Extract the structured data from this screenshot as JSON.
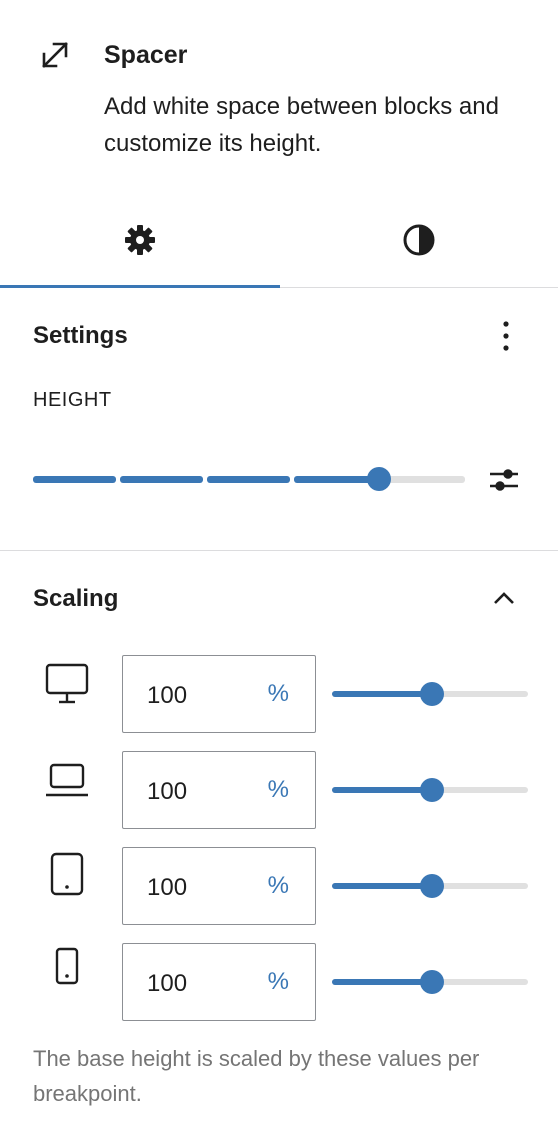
{
  "block": {
    "title": "Spacer",
    "description": "Add white space between blocks and customize its height.",
    "icon": "resize-arrows-icon"
  },
  "tabs": [
    {
      "name": "settings",
      "icon": "gear-icon",
      "active": true
    },
    {
      "name": "styles",
      "icon": "half-circle-contrast-icon",
      "active": false
    }
  ],
  "settings": {
    "title": "Settings",
    "height_label": "HEIGHT",
    "height_value_fraction": 0.8
  },
  "scaling": {
    "title": "Scaling",
    "rows": [
      {
        "device": "desktop-icon",
        "value": "100",
        "unit": "%",
        "slider_fraction": 0.5
      },
      {
        "device": "laptop-icon",
        "value": "100",
        "unit": "%",
        "slider_fraction": 0.5
      },
      {
        "device": "tablet-icon",
        "value": "100",
        "unit": "%",
        "slider_fraction": 0.5
      },
      {
        "device": "mobile-icon",
        "value": "100",
        "unit": "%",
        "slider_fraction": 0.5
      }
    ],
    "help": "The base height is scaled by these values per breakpoint."
  },
  "colors": {
    "accent": "#3a77b5",
    "track": "#e0e0e0",
    "help_text": "#757575"
  }
}
